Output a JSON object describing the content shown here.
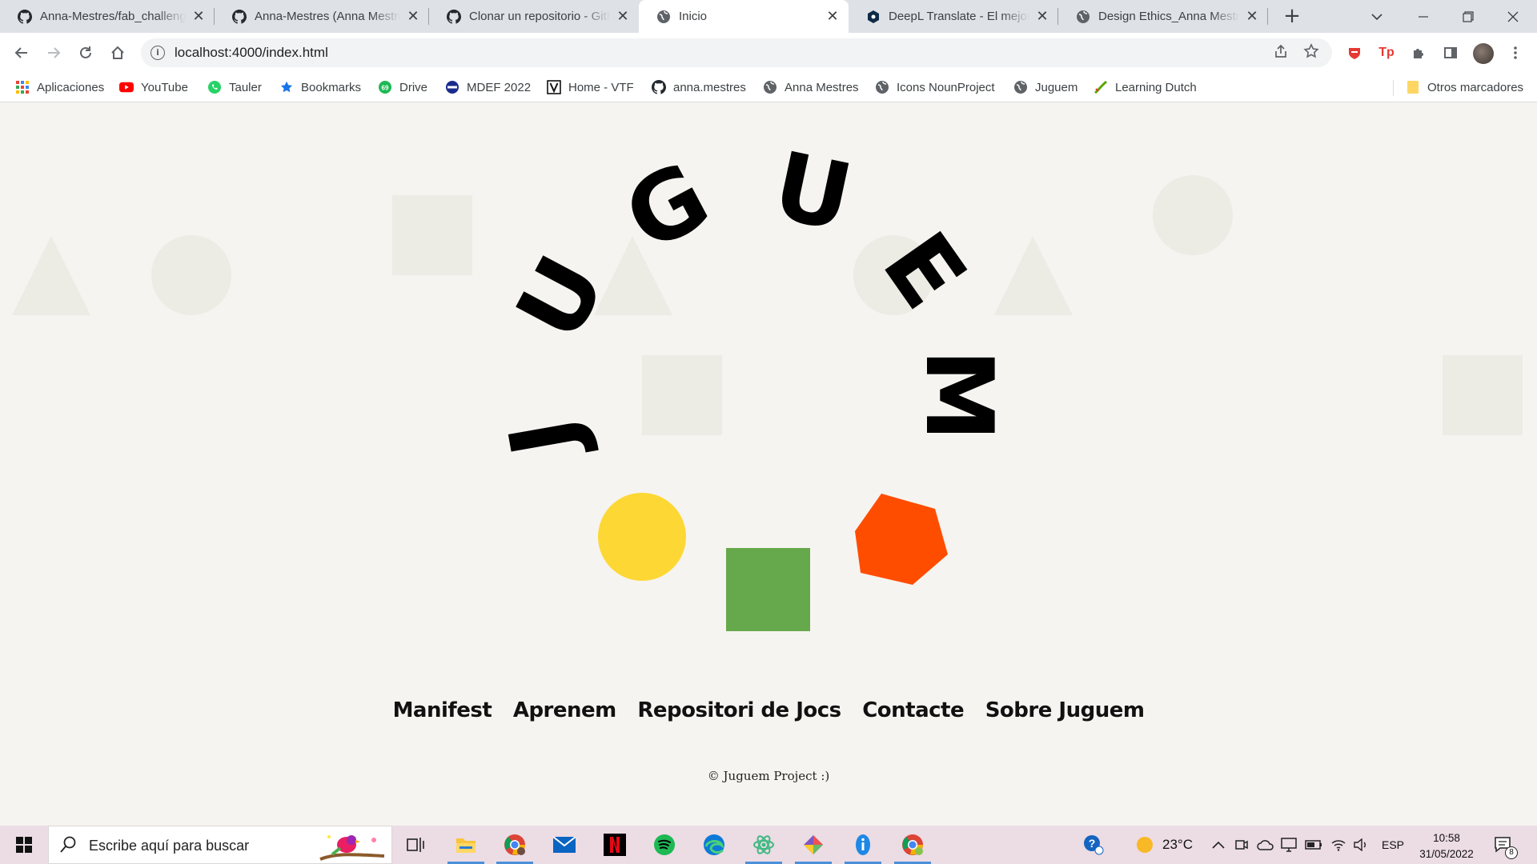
{
  "browser": {
    "tabs": [
      {
        "title": "Anna-Mestres/fab_challenge",
        "icon": "github-icon",
        "active": false
      },
      {
        "title": "Anna-Mestres (Anna Mestres)",
        "icon": "github-icon",
        "active": false
      },
      {
        "title": "Clonar un repositorio - GitHub",
        "icon": "github-icon",
        "active": false
      },
      {
        "title": "Inicio",
        "icon": "globe-icon",
        "active": true
      },
      {
        "title": "DeepL Translate - El mejor traductor",
        "icon": "deepl-icon",
        "active": false
      },
      {
        "title": "Design Ethics_Anna Mestres",
        "icon": "globe-icon",
        "active": false
      }
    ],
    "close_glyph": "✕",
    "new_tab_glyph": "+",
    "url": "localhost:4000/index.html",
    "bookmarks": [
      {
        "label": "Aplicaciones",
        "icon": "apps-grid-icon"
      },
      {
        "label": "YouTube",
        "icon": "youtube-icon"
      },
      {
        "label": "Tauler",
        "icon": "whatsapp-icon"
      },
      {
        "label": "Bookmarks",
        "icon": "star-icon"
      },
      {
        "label": "Drive",
        "icon": "drive-icon"
      },
      {
        "label": "MDEF 2022",
        "icon": "mdef-icon"
      },
      {
        "label": "Home - VTF",
        "icon": "vtf-icon"
      },
      {
        "label": "anna.mestres",
        "icon": "github-icon"
      },
      {
        "label": "Anna Mestres",
        "icon": "globe-icon"
      },
      {
        "label": "Icons NounProject",
        "icon": "globe-icon"
      },
      {
        "label": "Juguem",
        "icon": "globe-icon"
      },
      {
        "label": "Learning Dutch",
        "icon": "duolingo-icon"
      }
    ],
    "other_bookmarks": "Otros marcadores",
    "colors": {
      "tabstrip": "#dee1e6",
      "toolbar": "#ffffff"
    }
  },
  "site": {
    "logo_letters": [
      "J",
      "U",
      "G",
      "U",
      "E",
      "M"
    ],
    "nav": [
      "Manifest",
      "Aprenem",
      "Repositori de Jocs",
      "Contacte",
      "Sobre Juguem"
    ],
    "footer": "© Juguem Project :)",
    "colors": {
      "background": "#f6f4f0",
      "ghost_shapes": "#ecebe4",
      "yellow": "#fdd835",
      "green": "#66a84c",
      "orange": "#ff4d00",
      "text": "#111111"
    }
  },
  "taskbar": {
    "search_placeholder": "Escribe aquí para buscar",
    "apps": [
      "task-view-icon",
      "file-explorer-icon",
      "chrome-icon",
      "mail-icon",
      "netflix-icon",
      "spotify-icon",
      "edge-icon",
      "atom-icon",
      "kite-icon",
      "info-app-icon",
      "chrome-profile-icon"
    ],
    "weather": "23°C",
    "language": "ESP",
    "time": "10:58",
    "date": "31/05/2022",
    "notifications": "8"
  }
}
